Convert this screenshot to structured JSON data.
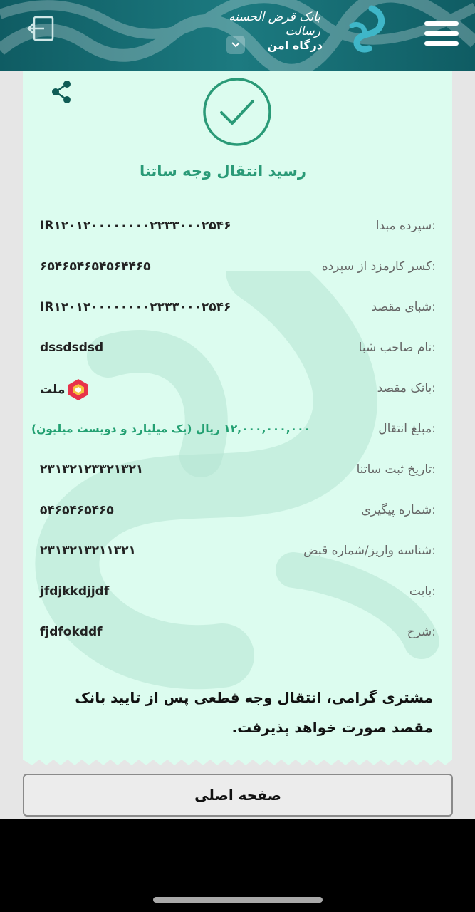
{
  "header": {
    "bank_name": "بانک قرض الحسنه رسالت",
    "gateway_label": "درگاه امن"
  },
  "receipt": {
    "title": "رسید انتقال وجه ساتنا",
    "rows": [
      {
        "label": "سپرده مبدا:",
        "value": "IR۱۲۰۱۲۰۰۰۰۰۰۰۰۲۲۳۳۰۰۰۲۵۴۶"
      },
      {
        "label": "کسر کارمزد از سپرده:",
        "value": "۶۵۴۶۵۴۶۵۴۵۶۴۴۶۵"
      },
      {
        "label": "شبای مقصد:",
        "value": "IR۱۲۰۱۲۰۰۰۰۰۰۰۰۲۲۳۳۰۰۰۲۵۴۶"
      },
      {
        "label": "نام صاحب شبا:",
        "value": "dssdsdsd"
      },
      {
        "label": "بانک مقصد:",
        "value": "ملت"
      },
      {
        "label": "مبلغ انتقال:",
        "value": "۱۲,۰۰۰,۰۰۰,۰۰۰ ریال (یک میلیارد و دویست میلیون)"
      },
      {
        "label": "تاریخ ثبت ساتنا:",
        "value": "۲۳۱۳۲۱۲۳۳۲۱۳۲۱"
      },
      {
        "label": "شماره پیگیری:",
        "value": "۵۴۶۵۴۶۵۴۶۵"
      },
      {
        "label": "شناسه واریز/شماره قبض:",
        "value": "۲۳۱۳۲۱۳۲۱۱۳۲۱"
      },
      {
        "label": "بابت:",
        "value": "jfdjkkdjjdf"
      },
      {
        "label": "شرح:",
        "value": "fjdfokddf"
      }
    ],
    "note": "مشتری گرامی، انتقال وجه قطعی پس از تایید بانک مقصد صورت خواهد پذیرفت."
  },
  "footer": {
    "home_button": "صفحه اصلی"
  },
  "colors": {
    "header_bg": "#0f5c63",
    "receipt_bg": "#dcfcef",
    "accent_green": "#2a9a77"
  },
  "icons": [
    "logout-icon",
    "chevron-down-icon",
    "brand-logo",
    "menu-icon",
    "share-icon",
    "checkmark-icon",
    "mellat-bank-logo"
  ]
}
